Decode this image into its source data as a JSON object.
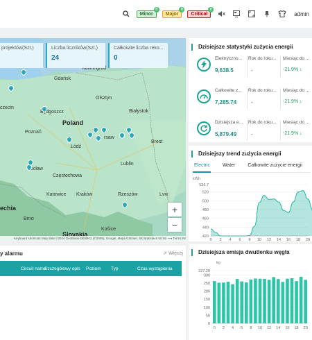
{
  "topbar": {
    "search_icon": "search-icon",
    "alarms": [
      {
        "label": "Minor",
        "count": "0",
        "style": "minor"
      },
      {
        "label": "Major",
        "count": "0",
        "style": "major"
      },
      {
        "label": "Critical",
        "count": "0",
        "style": "critical"
      }
    ],
    "user": "admin"
  },
  "map": {
    "kpis": [
      {
        "label": "projektów(Szt.)",
        "value": ""
      },
      {
        "label": "Liczba liczników(Szt.)",
        "value": "24"
      },
      {
        "label": "Całkowite liczba reko...",
        "value": "0"
      }
    ],
    "labels": {
      "gdansk": "Gdańsk",
      "kaliningrad": "Kaliningrad",
      "szczecin": "czecin",
      "bydgoszcz": "Bydgoszcz",
      "olsztyn": "Olsztyn",
      "poland": "Poland",
      "bialystok": "Białystok",
      "poznan": "Poznań",
      "warsaw": "rsaw",
      "lodz": "Łódź",
      "wroclaw": "ocław",
      "lublin": "Lublin",
      "czestochowa": "Częstochowa",
      "katowice": "Katowice",
      "krakow": "Kraków",
      "rzeszow": "Rzeszów",
      "lviv": "Lviv",
      "czechia": "echia",
      "brno": "Brno",
      "kosice": "Košice",
      "slovakia": "Slovakia",
      "brest": "Brest"
    },
    "zoom_in": "+",
    "zoom_out": "−",
    "attribution": "Keyboard shortcuts   Map data ©2024 GeoBasis-DE/BKG (©2009), Google, Mapa GISrael, SK Bratislava   50 km ⟶   Terms  Report a map error"
  },
  "alarm": {
    "title": "y alarmu",
    "more": "⇗ Więcej",
    "columns": [
      "Circuit name",
      "Szczegółowy opis",
      "Poziom",
      "Typ",
      "Czas wystąpienia"
    ]
  },
  "stats": {
    "title": "Dzisiejsze statystyki zużycia energii",
    "items": [
      {
        "icon": "lightning-icon",
        "label": "Elektryczno...",
        "value": "9,638.5",
        "rk_label": "Rok do roku...",
        "rk_value": "-",
        "mc_label": "Miesiąc do ...",
        "mc_value": "-21.9%"
      },
      {
        "icon": "gauge-icon",
        "label": "Całkowite z...",
        "value": "7,285.74",
        "rk_label": "Rok do roku...",
        "rk_value": "-",
        "mc_label": "Miesiąc do ...",
        "mc_value": "-21.9%"
      },
      {
        "icon": "recycle-icon",
        "label": "Dzisiejsza e...",
        "value": "5,879.49",
        "rk_label": "Rok do roku...",
        "rk_value": "-",
        "mc_label": "Miesiąc do ...",
        "mc_value": "-21.9%"
      }
    ]
  },
  "trend": {
    "title": "Dzisiejszy trend zużycia energii",
    "tabs": [
      "Electric",
      "Water",
      "Całkowite zużycie energii"
    ],
    "unit": "kWh"
  },
  "co2": {
    "title": "Dzisiejsza emisja dwutlenku węgla",
    "unit": "kg"
  },
  "chart_data": [
    {
      "type": "area",
      "ylabel": "kWh",
      "ylim": [
        420,
        536.7
      ],
      "yticks": [
        "536.7",
        "520",
        "500",
        "480",
        "460",
        "440",
        "420"
      ],
      "xticks": [
        "0",
        "2",
        "4",
        "6",
        "8",
        "10",
        "12",
        "14",
        "16",
        "18",
        "20"
      ],
      "x": [
        0,
        1,
        2,
        3,
        4,
        5,
        6,
        7,
        8,
        9,
        10,
        11,
        12,
        13,
        14,
        15,
        16,
        17,
        18,
        19,
        20,
        21,
        22,
        23
      ],
      "values": [
        436,
        428,
        420,
        420,
        420,
        420,
        420,
        420,
        421,
        442,
        496,
        512,
        503,
        504,
        497,
        478,
        473,
        497,
        520,
        523,
        504,
        479,
        493,
        526
      ],
      "color": "#29b8a4"
    },
    {
      "type": "bar",
      "ylabel": "kg",
      "ylim": [
        0,
        327.29
      ],
      "yticks": [
        "327.29",
        "300",
        "250",
        "200",
        "150",
        "100",
        "50",
        "0"
      ],
      "xticks": [
        "0",
        "2",
        "4",
        "6",
        "8",
        "10",
        "12",
        "14",
        "16",
        "18",
        "20"
      ],
      "x": [
        0,
        1,
        2,
        3,
        4,
        5,
        6,
        7,
        8,
        9,
        10,
        11,
        12,
        13,
        14,
        15,
        16,
        17,
        18,
        19,
        20
      ],
      "values": [
        262,
        252,
        253,
        258,
        243,
        275,
        260,
        254,
        272,
        278,
        277,
        276,
        270,
        287,
        275,
        257,
        277,
        280,
        262,
        289,
        270
      ],
      "color": "#2ec4a8"
    }
  ]
}
